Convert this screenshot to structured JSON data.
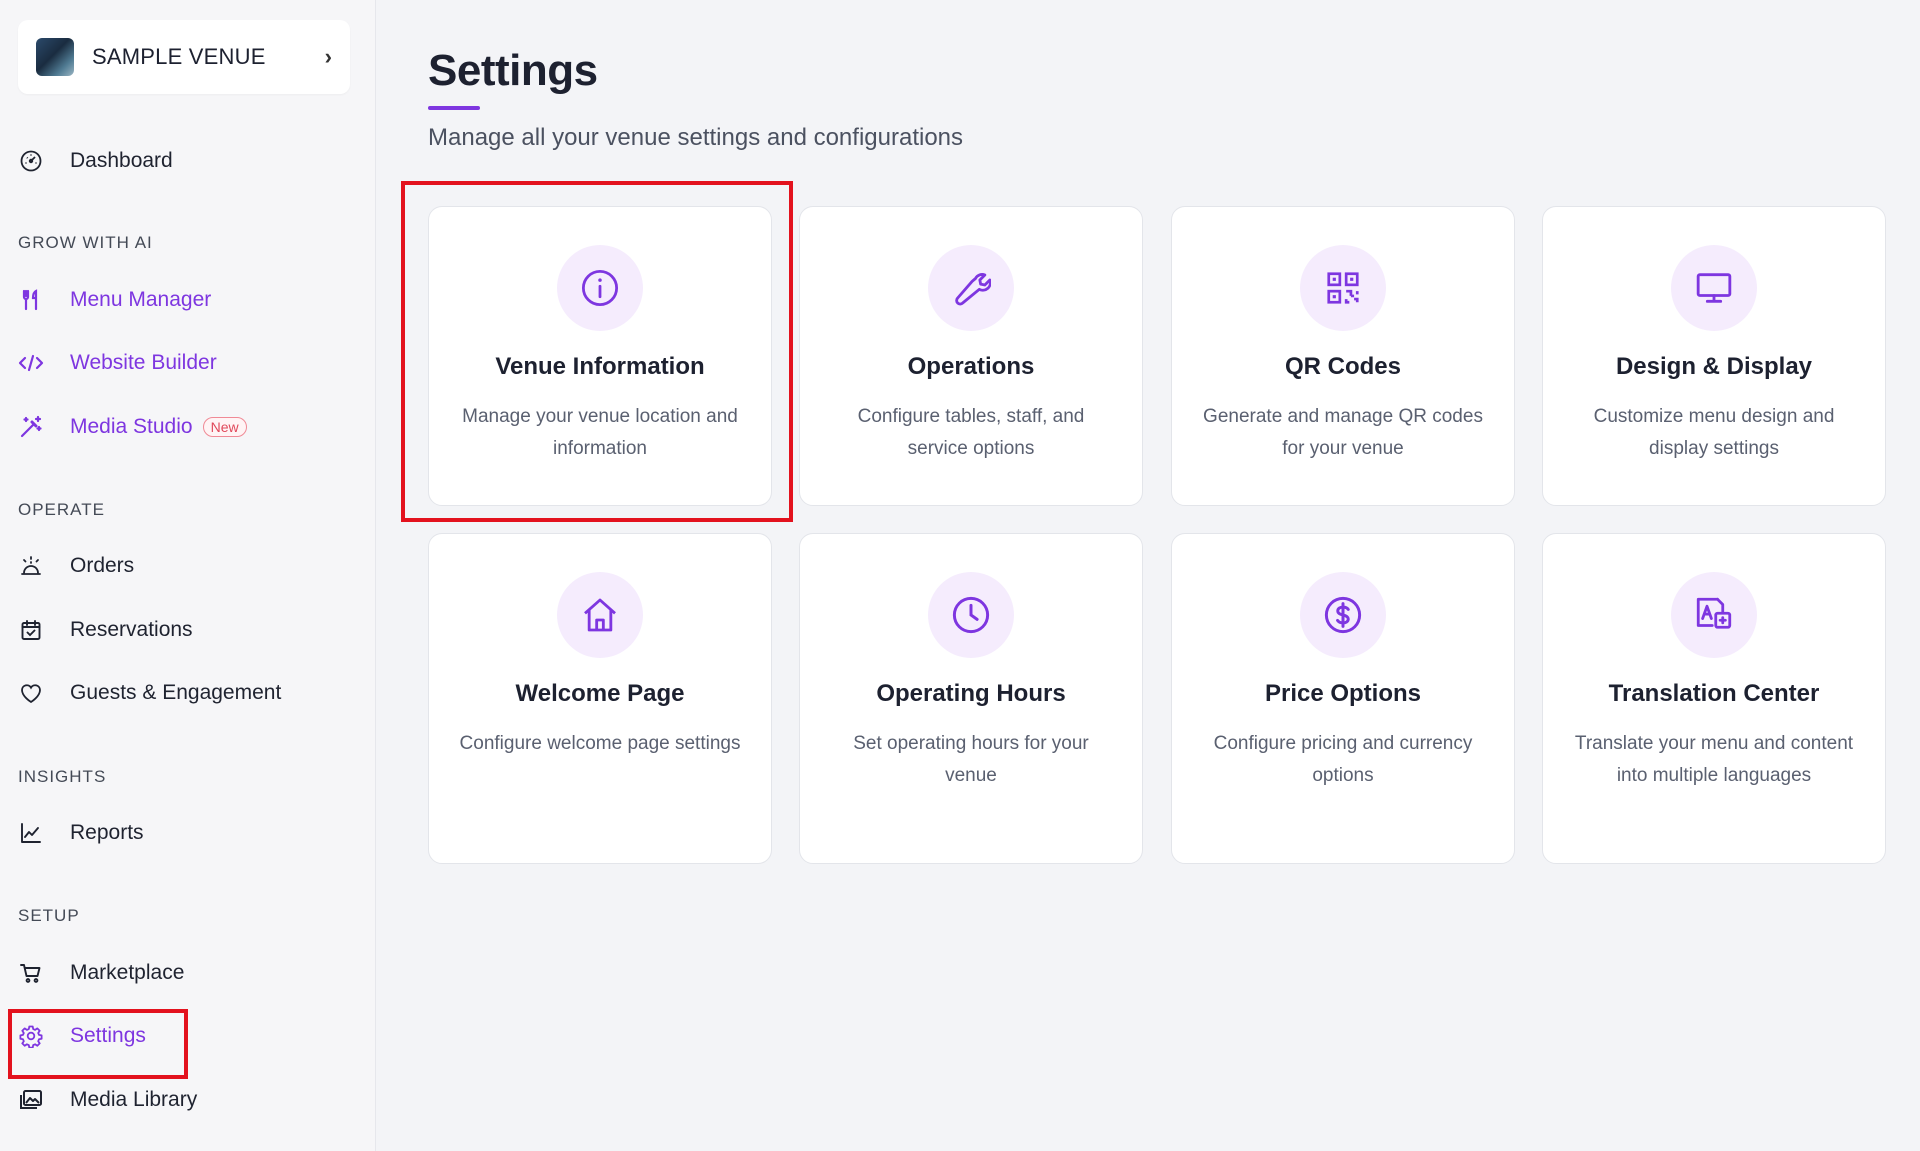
{
  "venue": {
    "name": "SAMPLE VENUE",
    "chevron_icon": "chevron-right-icon"
  },
  "sidebar": {
    "dashboard": {
      "label": "Dashboard",
      "icon": "gauge-icon"
    },
    "sections": {
      "grow": "GROW WITH AI",
      "operate": "OPERATE",
      "insights": "INSIGHTS",
      "setup": "SETUP"
    },
    "grow_items": [
      {
        "label": "Menu Manager",
        "icon": "utensils-icon"
      },
      {
        "label": "Website Builder",
        "icon": "code-icon"
      },
      {
        "label": "Media Studio",
        "icon": "magic-wand-icon",
        "badge": "New"
      }
    ],
    "operate_items": [
      {
        "label": "Orders",
        "icon": "bell-icon"
      },
      {
        "label": "Reservations",
        "icon": "calendar-check-icon"
      },
      {
        "label": "Guests & Engagement",
        "icon": "heart-icon"
      }
    ],
    "insights_items": [
      {
        "label": "Reports",
        "icon": "line-chart-icon"
      }
    ],
    "setup_items": [
      {
        "label": "Marketplace",
        "icon": "cart-icon"
      },
      {
        "label": "Settings",
        "icon": "gear-icon",
        "active": true
      },
      {
        "label": "Media Library",
        "icon": "images-icon"
      }
    ]
  },
  "page": {
    "title": "Settings",
    "subtitle": "Manage all your venue settings and configurations"
  },
  "cards": [
    {
      "title": "Venue Information",
      "desc": "Manage your venue location and information",
      "icon": "info-icon"
    },
    {
      "title": "Operations",
      "desc": "Configure tables, staff, and service options",
      "icon": "wrench-icon"
    },
    {
      "title": "QR Codes",
      "desc": "Generate and manage QR codes for your venue",
      "icon": "qr-code-icon"
    },
    {
      "title": "Design & Display",
      "desc": "Customize menu design and display settings",
      "icon": "monitor-icon"
    },
    {
      "title": "Welcome Page",
      "desc": "Configure welcome page settings",
      "icon": "home-icon"
    },
    {
      "title": "Operating Hours",
      "desc": "Set operating hours for your venue",
      "icon": "clock-icon"
    },
    {
      "title": "Price Options",
      "desc": "Configure pricing and currency options",
      "icon": "dollar-circle-icon"
    },
    {
      "title": "Translation Center",
      "desc": "Translate your menu and content into multiple languages",
      "icon": "translate-icon"
    }
  ],
  "colors": {
    "accent": "#7e36e0",
    "highlight": "#e3121e",
    "icon_bg": "#f5ecfd"
  }
}
